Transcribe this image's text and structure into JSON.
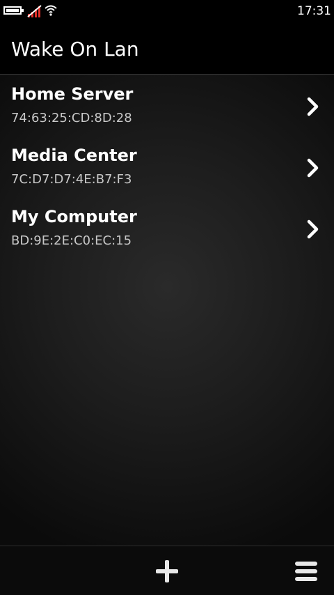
{
  "status_bar": {
    "time": "17:31",
    "icons": [
      "battery-icon",
      "signal-icon",
      "wifi-icon"
    ]
  },
  "header": {
    "title": "Wake On Lan"
  },
  "devices": [
    {
      "name": "Home Server",
      "mac": "74:63:25:CD:8D:28"
    },
    {
      "name": "Media Center",
      "mac": "7C:D7:D7:4E:B7:F3"
    },
    {
      "name": "My Computer",
      "mac": "BD:9E:2E:C0:EC:15"
    }
  ],
  "toolbar": {
    "icons": [
      "add-icon",
      "menu-icon"
    ]
  },
  "colors": {
    "background": "#000000",
    "text": "#ffffff",
    "secondary_text": "#c8c8c8",
    "signal_accent": "#e0302a"
  }
}
